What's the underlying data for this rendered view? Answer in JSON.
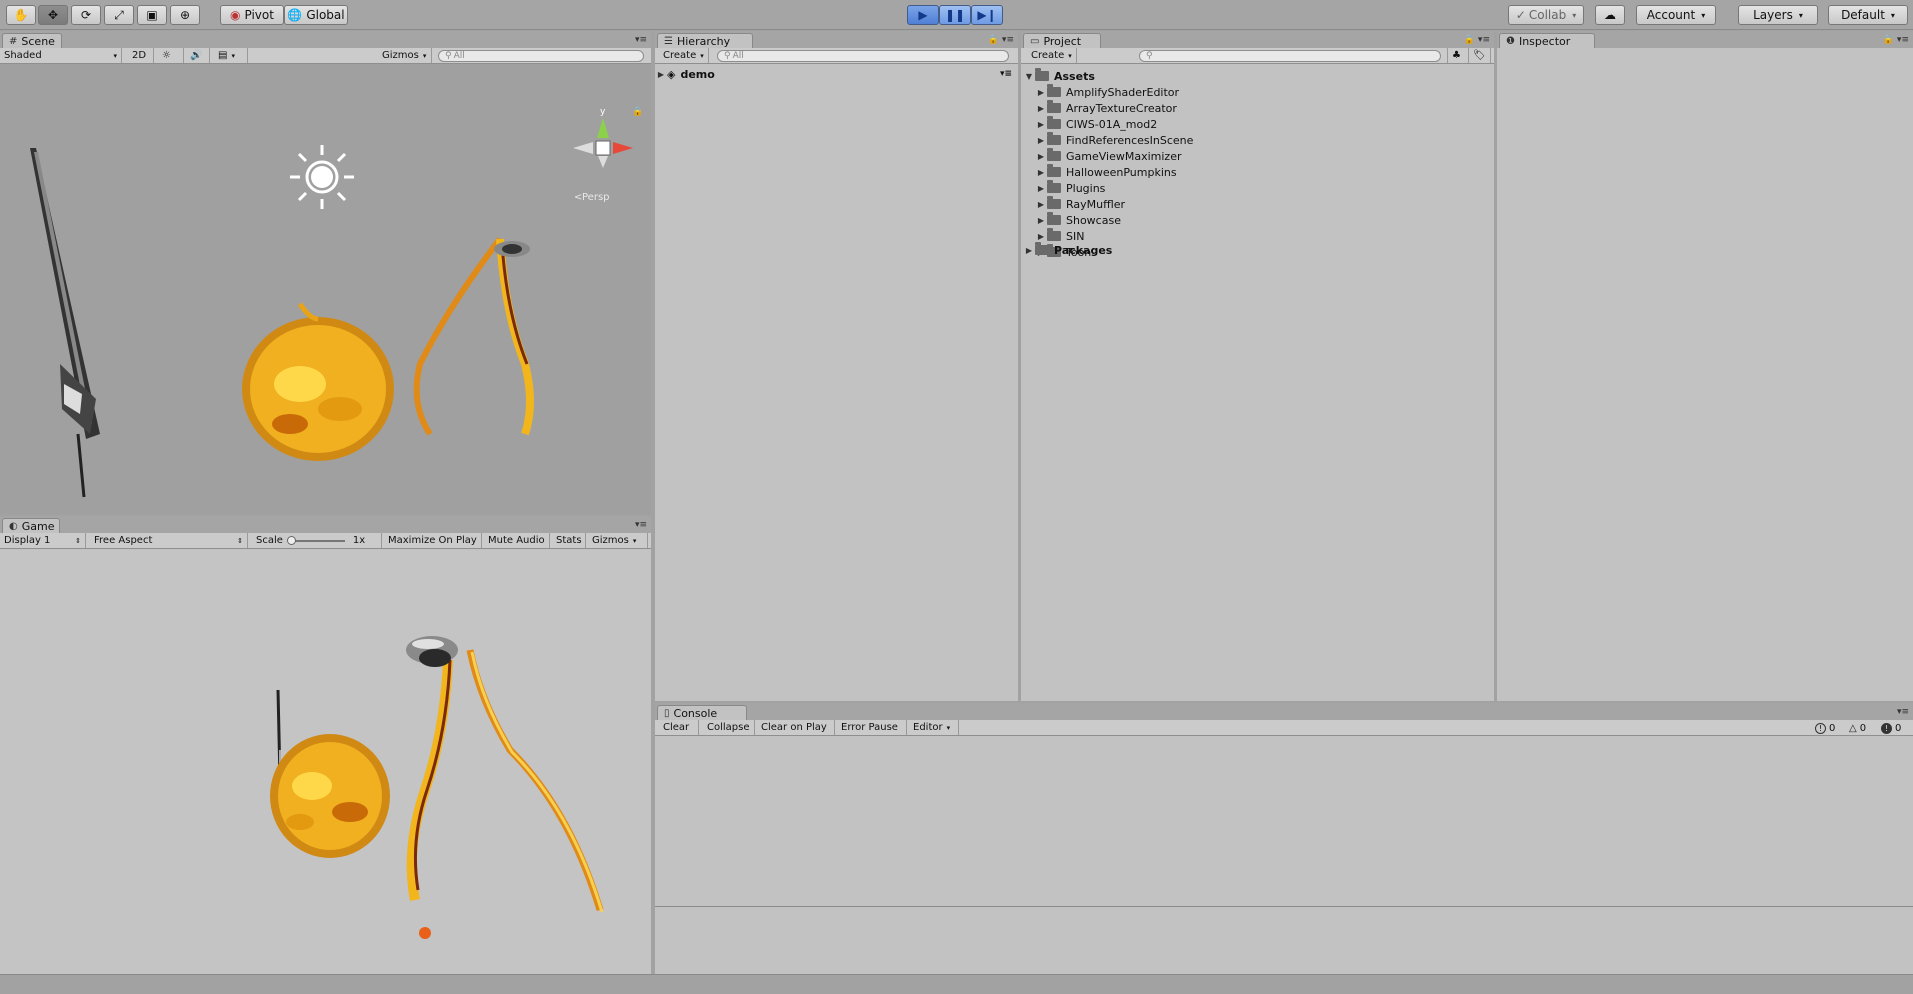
{
  "toolbar": {
    "pivot_label": "Pivot",
    "global_label": "Global",
    "collab_label": "Collab",
    "account_label": "Account",
    "layers_label": "Layers",
    "layout_label": "Default",
    "tools": [
      "hand-tool-icon",
      "move-tool-icon",
      "rotate-tool-icon",
      "scale-tool-icon",
      "rect-tool-icon",
      "transform-tool-icon"
    ]
  },
  "scene": {
    "tab_label": "Scene",
    "shading_mode": "Shaded",
    "mode_2d_label": "2D",
    "gizmos_label": "Gizmos",
    "search_placeholder": "All",
    "persp_label": "Persp",
    "gizmo_axis_y": "y"
  },
  "game": {
    "tab_label": "Game",
    "display_label": "Display 1",
    "aspect_label": "Free Aspect",
    "scale_label": "Scale",
    "scale_value": "1x",
    "maximize_label": "Maximize On Play",
    "mute_label": "Mute Audio",
    "stats_label": "Stats",
    "gizmos_label": "Gizmos"
  },
  "hierarchy": {
    "tab_label": "Hierarchy",
    "create_label": "Create",
    "search_placeholder": "All",
    "scene_name": "demo"
  },
  "project": {
    "tab_label": "Project",
    "create_label": "Create",
    "assets_label": "Assets",
    "folders": [
      "AmplifyShaderEditor",
      "ArrayTextureCreator",
      "CIWS-01A_mod2",
      "FindReferencesInScene",
      "GameViewMaximizer",
      "HalloweenPumpkins",
      "Plugins",
      "RayMuffler",
      "Showcase",
      "SIN",
      "Toon"
    ],
    "packages_label": "Packages"
  },
  "inspector": {
    "tab_label": "Inspector"
  },
  "console": {
    "tab_label": "Console",
    "clear_label": "Clear",
    "collapse_label": "Collapse",
    "clear_on_play_label": "Clear on Play",
    "error_pause_label": "Error Pause",
    "editor_label": "Editor",
    "info_count": "0",
    "warning_count": "0",
    "error_count": "0"
  },
  "colors": {
    "play_accent": "#4f7fd6",
    "panel_bg": "#c2c2c2",
    "scene_bg": "#a0a0a0",
    "game_bg": "#c4c4c4"
  }
}
